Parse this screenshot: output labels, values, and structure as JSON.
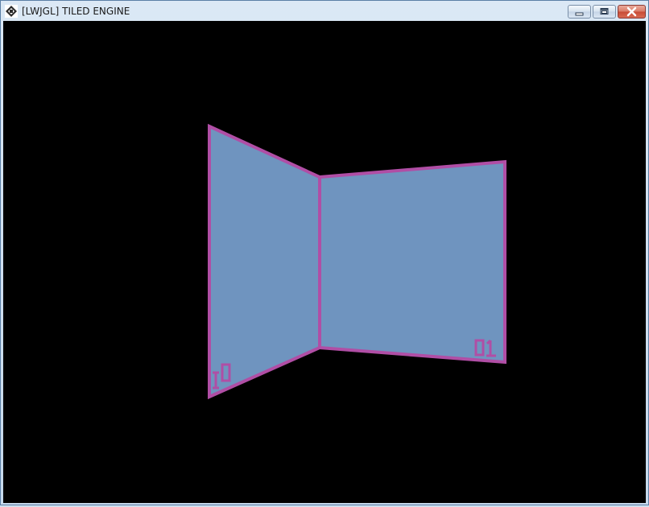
{
  "window": {
    "title": "[LWJGL] TILED ENGINE",
    "controls": {
      "minimize": "minimize",
      "maximize": "maximize",
      "close": "close"
    }
  },
  "scene": {
    "background_color": "#000000",
    "wall_fill_color": "#6f94bf",
    "wall_border_color": "#b04ea5",
    "walls": [
      {
        "label": "01",
        "orientation": "left-mirrored"
      },
      {
        "label": "01",
        "orientation": "right"
      }
    ]
  }
}
